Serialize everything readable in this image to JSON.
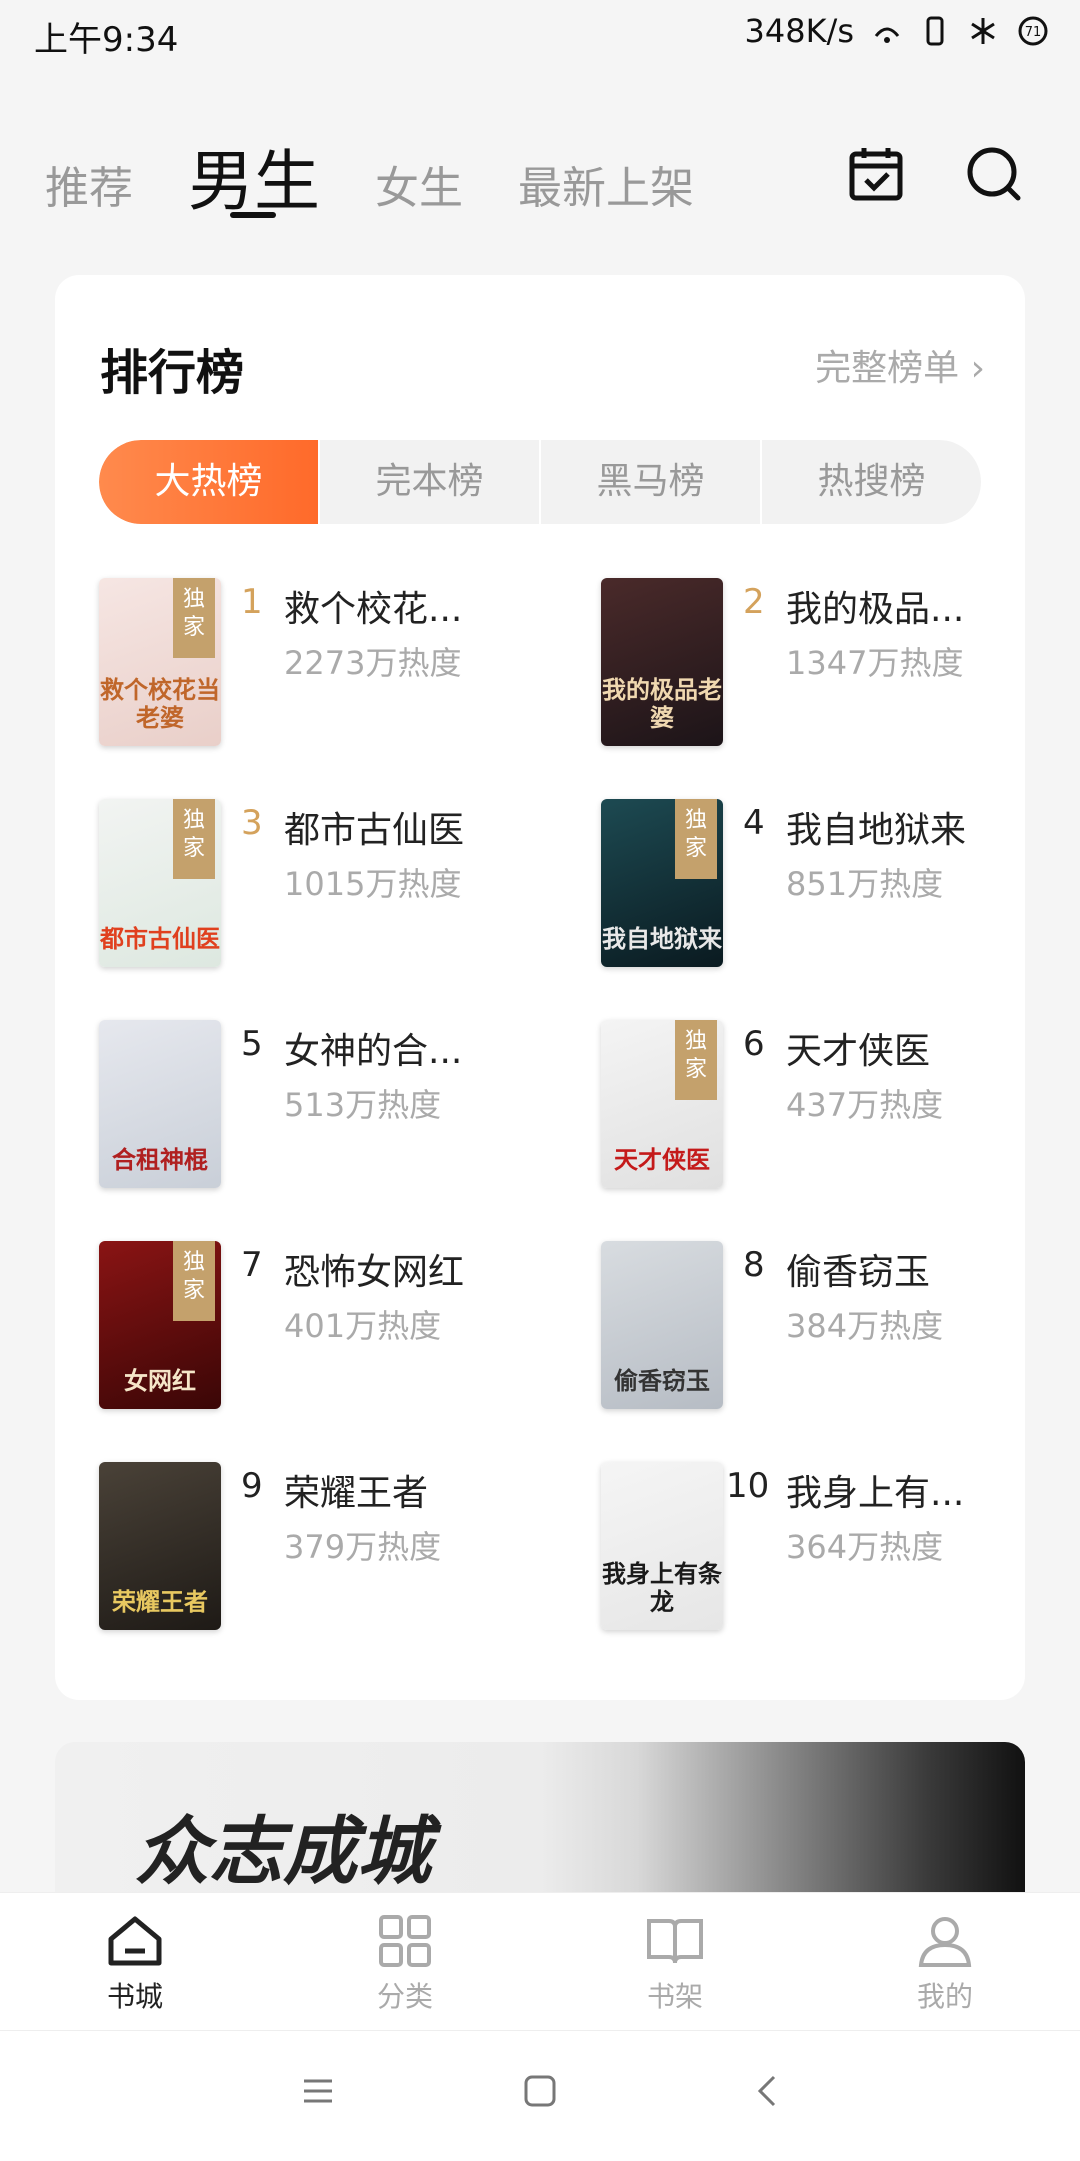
{
  "status_bar": {
    "time": "上午9:34",
    "speed": "348K/s",
    "battery": "71"
  },
  "top_tabs": [
    {
      "label": "推荐",
      "active": false
    },
    {
      "label": "男生",
      "active": true
    },
    {
      "label": "女生",
      "active": false
    },
    {
      "label": "最新上架",
      "active": false
    }
  ],
  "icons": {
    "calendar": "calendar-check-icon",
    "search": "search-icon"
  },
  "ranking": {
    "title": "排行榜",
    "more": "完整榜单 ›",
    "segments": [
      "大热榜",
      "完本榜",
      "黑马榜",
      "热搜榜"
    ],
    "active_segment": 0,
    "books": [
      {
        "rank": "1",
        "title": "救个校花...",
        "heat": "2273万热度",
        "exclusive": true,
        "cover_text": "救个校花当老婆",
        "colors": [
          "#f6e6e3",
          "#e9cfc9"
        ],
        "ink": "#c0662a"
      },
      {
        "rank": "2",
        "title": "我的极品...",
        "heat": "1347万热度",
        "exclusive": false,
        "cover_text": "我的极品老婆",
        "colors": [
          "#4a2a2a",
          "#1c1418"
        ],
        "ink": "#f0d8b0"
      },
      {
        "rank": "3",
        "title": "都市古仙医",
        "heat": "1015万热度",
        "exclusive": true,
        "cover_text": "都市古仙医",
        "colors": [
          "#f2f4f2",
          "#dde8e0"
        ],
        "ink": "#e0401e"
      },
      {
        "rank": "4",
        "title": "我自地狱来",
        "heat": "851万热度",
        "exclusive": true,
        "cover_text": "我自地狱来",
        "colors": [
          "#1d4a52",
          "#0a1a20"
        ],
        "ink": "#e8e8e8"
      },
      {
        "rank": "5",
        "title": "女神的合...",
        "heat": "513万热度",
        "exclusive": false,
        "cover_text": "合租神棍",
        "colors": [
          "#e6e8ee",
          "#c9cfd8"
        ],
        "ink": "#b02020"
      },
      {
        "rank": "6",
        "title": "天才侠医",
        "heat": "437万热度",
        "exclusive": true,
        "cover_text": "天才侠医",
        "colors": [
          "#f4f4f4",
          "#e0e0e0"
        ],
        "ink": "#c41a1a"
      },
      {
        "rank": "7",
        "title": "恐怖女网红",
        "heat": "401万热度",
        "exclusive": true,
        "cover_text": "女网红",
        "colors": [
          "#8a1414",
          "#3a0606"
        ],
        "ink": "#f5e6c8"
      },
      {
        "rank": "8",
        "title": "偷香窃玉",
        "heat": "384万热度",
        "exclusive": false,
        "cover_text": "偷香窃玉",
        "colors": [
          "#d8dce0",
          "#b6bcc4"
        ],
        "ink": "#333333"
      },
      {
        "rank": "9",
        "title": "荣耀王者",
        "heat": "379万热度",
        "exclusive": false,
        "cover_text": "荣耀王者",
        "colors": [
          "#4a4238",
          "#1e1a16"
        ],
        "ink": "#e8c860"
      },
      {
        "rank": "10",
        "title": "我身上有...",
        "heat": "364万热度",
        "exclusive": false,
        "cover_text": "我身上有条龙",
        "colors": [
          "#f5f5f5",
          "#e6e6e6"
        ],
        "ink": "#1a1a1a"
      }
    ],
    "exclusive_label": "独家"
  },
  "banner": {
    "text": "众志成城"
  },
  "bottom_nav": [
    {
      "label": "书城",
      "icon": "bookstore-icon",
      "active": true
    },
    {
      "label": "分类",
      "icon": "category-grid-icon",
      "active": false
    },
    {
      "label": "书架",
      "icon": "bookshelf-icon",
      "active": false
    },
    {
      "label": "我的",
      "icon": "profile-icon",
      "active": false
    }
  ]
}
